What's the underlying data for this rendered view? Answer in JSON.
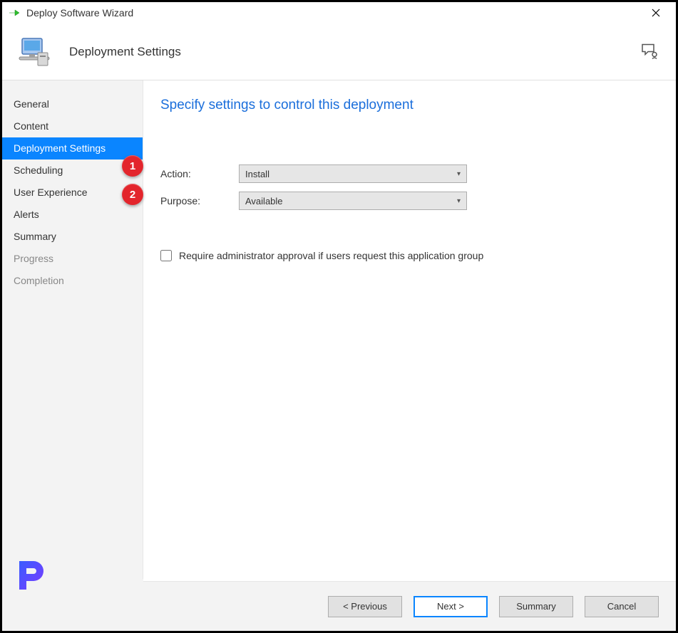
{
  "titlebar": {
    "title": "Deploy Software Wizard"
  },
  "header": {
    "title": "Deployment Settings"
  },
  "sidebar": {
    "items": [
      {
        "label": "General",
        "state": "normal"
      },
      {
        "label": "Content",
        "state": "normal"
      },
      {
        "label": "Deployment Settings",
        "state": "active"
      },
      {
        "label": "Scheduling",
        "state": "normal"
      },
      {
        "label": "User Experience",
        "state": "normal"
      },
      {
        "label": "Alerts",
        "state": "normal"
      },
      {
        "label": "Summary",
        "state": "normal"
      },
      {
        "label": "Progress",
        "state": "disabled"
      },
      {
        "label": "Completion",
        "state": "disabled"
      }
    ]
  },
  "content": {
    "heading": "Specify settings to control this deployment",
    "action_label": "Action:",
    "action_value": "Install",
    "purpose_label": "Purpose:",
    "purpose_value": "Available",
    "checkbox_label": "Require administrator approval if users request this application group"
  },
  "callouts": {
    "one": "1",
    "two": "2"
  },
  "footer": {
    "previous": "< Previous",
    "next": "Next >",
    "summary": "Summary",
    "cancel": "Cancel"
  }
}
